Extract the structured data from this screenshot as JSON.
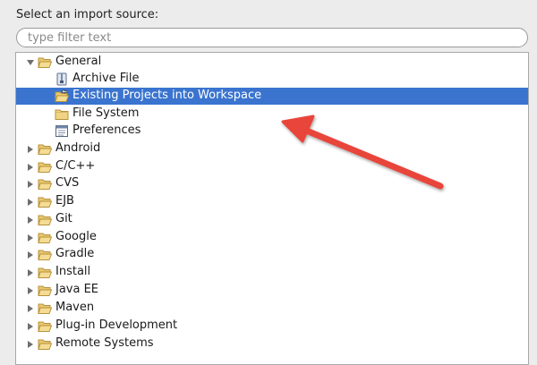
{
  "prompt": "Select an import source:",
  "filter": {
    "placeholder": "type filter text",
    "value": ""
  },
  "tree": {
    "general": {
      "label": "General",
      "icon": "folder-open-icon",
      "children": [
        {
          "label": "Archive File",
          "icon": "archive-file-icon"
        },
        {
          "label": "Existing Projects into Workspace",
          "icon": "import-projects-icon"
        },
        {
          "label": "File System",
          "icon": "folder-icon"
        },
        {
          "label": "Preferences",
          "icon": "preferences-icon"
        }
      ]
    },
    "categories": [
      {
        "label": "Android"
      },
      {
        "label": "C/C++"
      },
      {
        "label": "CVS"
      },
      {
        "label": "EJB"
      },
      {
        "label": "Git"
      },
      {
        "label": "Google"
      },
      {
        "label": "Gradle"
      },
      {
        "label": "Install"
      },
      {
        "label": "Java EE"
      },
      {
        "label": "Maven"
      },
      {
        "label": "Plug-in Development"
      },
      {
        "label": "Remote Systems"
      }
    ]
  },
  "colors": {
    "selection": "#3a74cf",
    "folder": "#e6c36a",
    "annotation_arrow": "#e8443a"
  }
}
